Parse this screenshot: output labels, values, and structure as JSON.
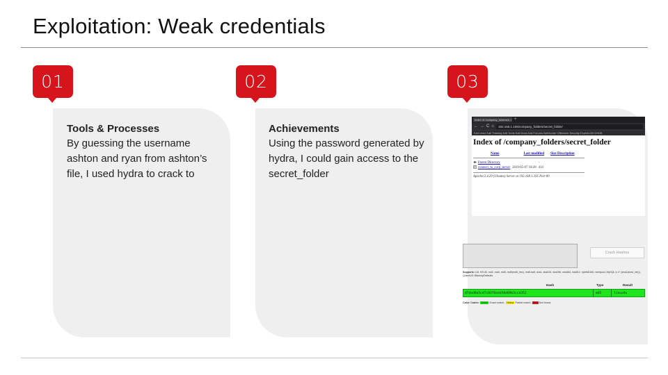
{
  "slide": {
    "title": "Exploitation: Weak credentials"
  },
  "steps": [
    {
      "number": "01",
      "heading": "Tools & Processes",
      "body": "By guessing the username ashton and ryan from ashton’s  file, I used hydra to crack to"
    },
    {
      "number": "02",
      "heading": "Achievements",
      "body": "Using the password generated by hydra, I could gain access to the secret_folder"
    },
    {
      "number": "03"
    }
  ],
  "screenshot": {
    "browser": {
      "tab_title": "Index of /company_folders/s",
      "tab_close": "×",
      "new_tab": "+",
      "nav_back": "←",
      "nav_forward": "→",
      "nav_reload": "C",
      "nav_home": "⌂",
      "url": "192.168.1.105/company_folders/secret_folder/",
      "bookmarks": "Kali Linux   Kali Training   Kali Tools   Kali Docs   Kali Forums   NetHunter   Offensive Security   Exploit-DB   GHDB",
      "page_heading": "Index of /company_folders/secret_folder",
      "columns": [
        "Name",
        "Last modified",
        "Size Description"
      ],
      "rows": [
        {
          "name": "Parent Directory",
          "modified": "",
          "size": "-"
        },
        {
          "name": "connect_to_corp_server",
          "modified": "2019-05-07 18:28",
          "size": "414"
        }
      ],
      "address_line": "Apache/2.4.29 (Ubuntu) Server at 192.168.1.105 Port 80"
    },
    "crackstation": {
      "button_label": "Crack Hashes",
      "supports_label": "Supports:",
      "supports_text": "LM, NTLM, md2, md4, md5, md5(md5_hex), md5-half, sha1, sha224, sha256, sha384, sha512, ripeMD160, whirlpool, MySQL 4.1+ (sha1(sha1_bin)), QubesV3.1BackupDefaults",
      "headers": [
        "Hash",
        "Type",
        "Result"
      ],
      "result_row": {
        "hash": "d7dad0a5cd7c8376eeb50d69b3ccd352",
        "type": "md5",
        "result": "linux4u"
      },
      "color_codes_label": "Color Codes:",
      "codes": [
        {
          "swatch": "Green",
          "text": "Exact match,"
        },
        {
          "swatch": "Yellow",
          "text": "Partial match,"
        },
        {
          "swatch": "Red",
          "text": "Not found."
        }
      ]
    }
  },
  "colors": {
    "accent": "#d6141b",
    "card": "#efefef",
    "match_green": "#1ee51e"
  }
}
